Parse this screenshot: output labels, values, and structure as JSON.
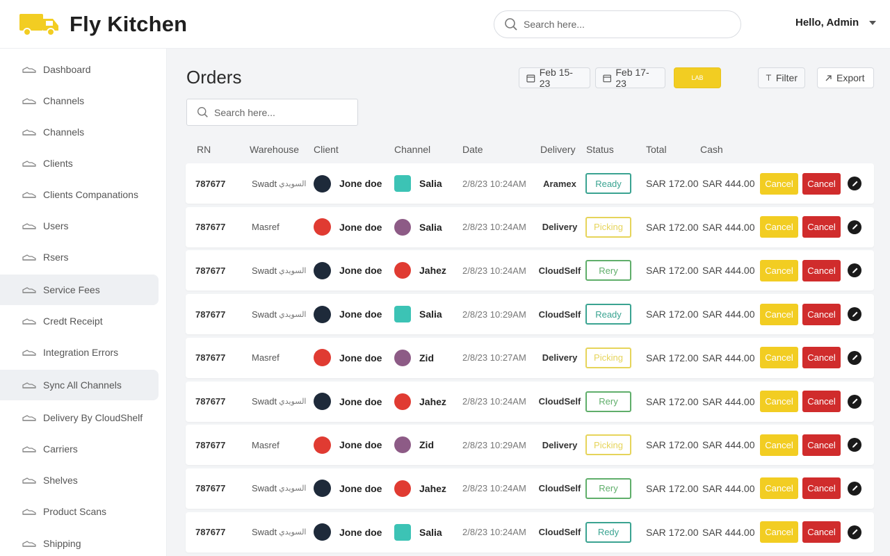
{
  "app": {
    "name": "Fly Kitchen",
    "brand_color": "#f2cd22"
  },
  "header": {
    "search_placeholder": "Search here...",
    "greeting": "Hello, Admin"
  },
  "sidebar": {
    "items": [
      {
        "label": "Dashboard",
        "icon": "shoe-icon"
      },
      {
        "label": "Channels",
        "icon": "shoe-icon"
      },
      {
        "label": "Channels",
        "icon": "shoe-icon"
      },
      {
        "label": "Clients",
        "icon": "shoe-icon"
      },
      {
        "label": "Clients Companations",
        "icon": "shoe-icon"
      },
      {
        "label": "Users",
        "icon": "shoe-icon"
      },
      {
        "label": "Rsers",
        "icon": "shoe-icon"
      },
      {
        "label": "Service Fees",
        "icon": "shoe-icon",
        "active": true
      },
      {
        "label": "Credt Receipt",
        "icon": "shoe-icon"
      },
      {
        "label": "Integration Errors",
        "icon": "shoe-icon"
      },
      {
        "label": "Sync All Channels",
        "icon": "shoe-icon",
        "active": true
      },
      {
        "label": "Delivery By CloudShelf",
        "icon": "shoe-icon"
      },
      {
        "label": "Carriers",
        "icon": "shoe-icon"
      },
      {
        "label": "Shelves",
        "icon": "shoe-icon"
      },
      {
        "label": "Product Scans",
        "icon": "shoe-icon"
      },
      {
        "label": "Shipping",
        "icon": "shoe-icon"
      }
    ]
  },
  "main": {
    "title": "Orders",
    "toolbar": {
      "date_from": "Feb 15-23",
      "date_to": "Feb 17-23",
      "yellow_label": "LAB",
      "filter": "Filter",
      "export": "Export"
    },
    "search_placeholder": "Search here...",
    "columns": [
      "RN",
      "Warehouse",
      "Client",
      "Channel",
      "Date",
      "Delivery",
      "Status",
      "Total",
      "Cash"
    ],
    "rows": [
      {
        "rn": "787677",
        "warehouse": "Swadt",
        "warehouse_ar": "السويدي",
        "client": "Jone doe",
        "client_logo": "dark",
        "channel": "Salia",
        "channel_icon": "teal",
        "date": "2/8/23  10:24AM",
        "delivery": "Aramex",
        "status": "Ready",
        "status_color": "#3aa391",
        "total": "SAR 172.00",
        "cash": "SAR 444.00",
        "cancel_yellow": "Cancel",
        "cancel_red": "Cancel"
      },
      {
        "rn": "787677",
        "warehouse": "Masref",
        "warehouse_ar": "",
        "client": "Jone doe",
        "client_logo": "red",
        "channel": "Salia",
        "channel_icon": "purple",
        "date": "2/8/23  10:24AM",
        "delivery": "Delivery",
        "status": "Picking",
        "status_color": "#e6d45a",
        "total": "SAR 172.00",
        "cash": "SAR 444.00",
        "cancel_yellow": "Cancel",
        "cancel_red": "Cancel"
      },
      {
        "rn": "787677",
        "warehouse": "Swadt",
        "warehouse_ar": "السويدي",
        "client": "Jone doe",
        "client_logo": "dark",
        "channel": "Jahez",
        "channel_icon": "red",
        "date": "2/8/23  10:24AM",
        "delivery": "CloudSelf",
        "status": "Rery",
        "status_color": "#5fae6a",
        "total": "SAR 172.00",
        "cash": "SAR 444.00",
        "cancel_yellow": "Cancel",
        "cancel_red": "Cancel"
      },
      {
        "rn": "787677",
        "warehouse": "Swadt",
        "warehouse_ar": "السويدي",
        "client": "Jone doe",
        "client_logo": "dark",
        "channel": "Salia",
        "channel_icon": "teal",
        "date": "2/8/23  10:29AM",
        "delivery": "CloudSelf",
        "status": "Ready",
        "status_color": "#3aa391",
        "total": "SAR 172.00",
        "cash": "SAR 444.00",
        "cancel_yellow": "Cancel",
        "cancel_red": "Cancel"
      },
      {
        "rn": "787677",
        "warehouse": "Masref",
        "warehouse_ar": "",
        "client": "Jone doe",
        "client_logo": "red",
        "channel": "Zid",
        "channel_icon": "purple",
        "date": "2/8/23  10:27AM",
        "delivery": "Delivery",
        "status": "Picking",
        "status_color": "#e6d45a",
        "total": "SAR 172.00",
        "cash": "SAR 444.00",
        "cancel_yellow": "Cancel",
        "cancel_red": "Cancel"
      },
      {
        "rn": "787677",
        "warehouse": "Swadt",
        "warehouse_ar": "السويدي",
        "client": "Jone doe",
        "client_logo": "dark",
        "channel": "Jahez",
        "channel_icon": "red",
        "date": "2/8/23  10:24AM",
        "delivery": "CloudSelf",
        "status": "Rery",
        "status_color": "#5fae6a",
        "total": "SAR 172.00",
        "cash": "SAR 444.00",
        "cancel_yellow": "Cancel",
        "cancel_red": "Cancel"
      },
      {
        "rn": "787677",
        "warehouse": "Masref",
        "warehouse_ar": "",
        "client": "Jone doe",
        "client_logo": "red",
        "channel": "Zid",
        "channel_icon": "purple",
        "date": "2/8/23  10:29AM",
        "delivery": "Delivery",
        "status": "Picking",
        "status_color": "#e6d45a",
        "total": "SAR 172.00",
        "cash": "SAR 444.00",
        "cancel_yellow": "Cancel",
        "cancel_red": "Cancel"
      },
      {
        "rn": "787677",
        "warehouse": "Swadt",
        "warehouse_ar": "السويدي",
        "client": "Jone doe",
        "client_logo": "dark",
        "channel": "Jahez",
        "channel_icon": "red",
        "date": "2/8/23  10:24AM",
        "delivery": "CloudSelf",
        "status": "Rery",
        "status_color": "#5fae6a",
        "total": "SAR 172.00",
        "cash": "SAR 444.00",
        "cancel_yellow": "Cancel",
        "cancel_red": "Cancel"
      },
      {
        "rn": "787677",
        "warehouse": "Swadt",
        "warehouse_ar": "السويدي",
        "client": "Jone doe",
        "client_logo": "dark",
        "channel": "Salia",
        "channel_icon": "teal",
        "date": "2/8/23  10:24AM",
        "delivery": "CloudSelf",
        "status": "Redy",
        "status_color": "#3aa391",
        "total": "SAR 172.00",
        "cash": "SAR 444.00",
        "cancel_yellow": "Cancel",
        "cancel_red": "Cancel"
      }
    ]
  }
}
